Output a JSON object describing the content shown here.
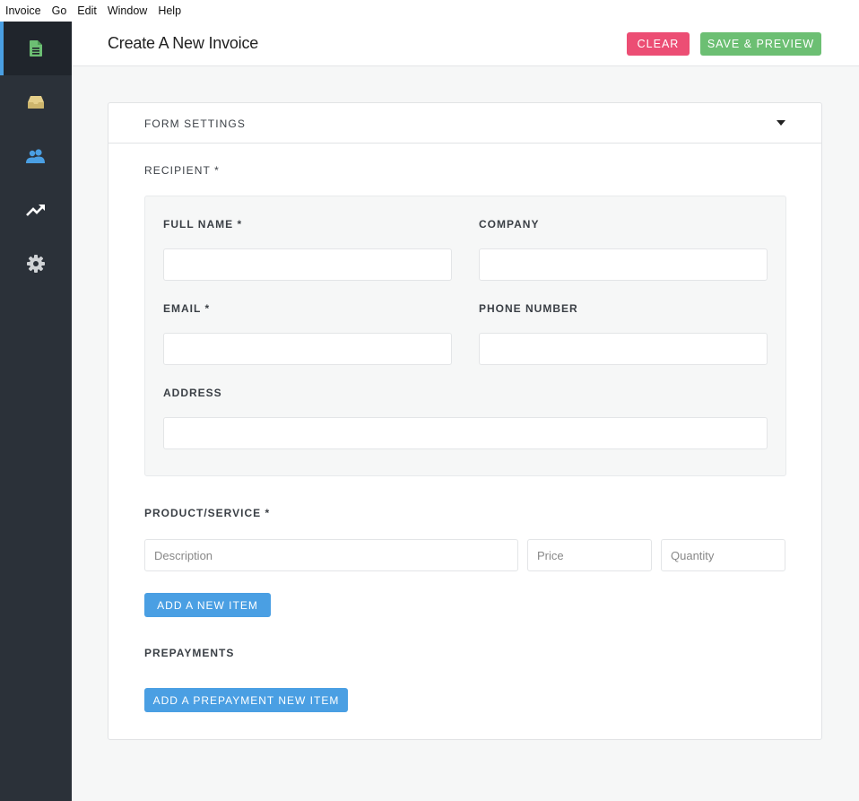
{
  "menu": [
    "Invoice",
    "Go",
    "Edit",
    "Window",
    "Help"
  ],
  "sidebar": {
    "items": [
      {
        "name": "invoice",
        "icon": "document-icon",
        "color": "#6cbf73",
        "active": true
      },
      {
        "name": "contacts-inbox",
        "icon": "inbox-icon",
        "color": "#e5cf8a",
        "active": false
      },
      {
        "name": "clients",
        "icon": "users-icon",
        "color": "#4a9fe3",
        "active": false
      },
      {
        "name": "statistics",
        "icon": "trending-up-icon",
        "color": "#ffffff",
        "active": false
      },
      {
        "name": "settings",
        "icon": "gear-icon",
        "color": "#d0d3d6",
        "active": false
      }
    ]
  },
  "header": {
    "title": "Create A New Invoice",
    "clear_label": "CLEAR",
    "save_label": "SAVE & PREVIEW"
  },
  "form": {
    "settings_label": "FORM SETTINGS",
    "recipient_label": "RECIPIENT *",
    "full_name_label": "FULL NAME *",
    "company_label": "COMPANY",
    "email_label": "EMAIL *",
    "phone_label": "PHONE NUMBER",
    "address_label": "ADDRESS",
    "product_label": "PRODUCT/SERVICE *",
    "description_placeholder": "Description",
    "price_placeholder": "Price",
    "quantity_placeholder": "Quantity",
    "add_item_label": "ADD A NEW ITEM",
    "prepayments_label": "PREPAYMENTS",
    "add_prepayment_label": "ADD A PREPAYMENT NEW ITEM"
  },
  "colors": {
    "clear": "#ec4e74",
    "save": "#6cbf73",
    "primary": "#4a9fe3",
    "sidebar_bg": "#2b3139"
  }
}
